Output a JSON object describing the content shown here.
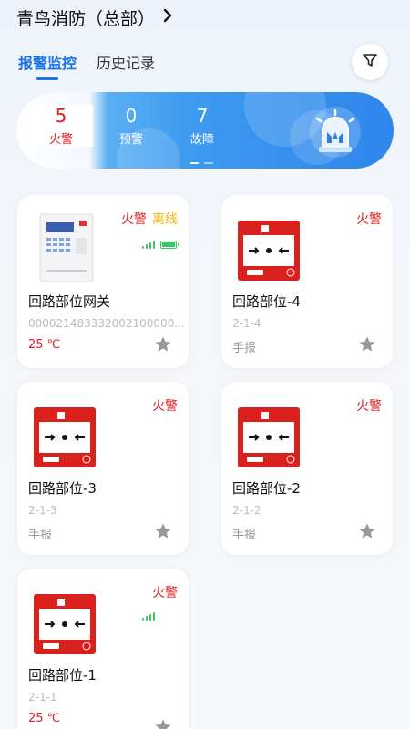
{
  "header": {
    "title": "青鸟消防（总部）"
  },
  "tabs": [
    {
      "label": "报警监控",
      "active": true
    },
    {
      "label": "历史记录",
      "active": false
    }
  ],
  "stats": [
    {
      "value": "5",
      "label": "火警",
      "color": "#e02020"
    },
    {
      "value": "0",
      "label": "预警",
      "color": "#ffffff"
    },
    {
      "value": "7",
      "label": "故障",
      "color": "#ffffff"
    }
  ],
  "banner": {
    "pages": 2,
    "current_page": 1
  },
  "devices": [
    {
      "name": "回路部位网关",
      "sub": "000021483332002100000...",
      "extra": "25 ℃",
      "badge_fire": "火警",
      "badge_offline": "离线",
      "type": "gateway",
      "signal_bars": 4,
      "battery": true,
      "favorite": false
    },
    {
      "name": "回路部位-4",
      "sub": "2-1-4",
      "extra": "手报",
      "badge_fire": "火警",
      "type": "manual-call-point",
      "favorite": false
    },
    {
      "name": "回路部位-3",
      "sub": "2-1-3",
      "extra": "手报",
      "badge_fire": "火警",
      "type": "manual-call-point",
      "favorite": false
    },
    {
      "name": "回路部位-2",
      "sub": "2-1-2",
      "extra": "手报",
      "badge_fire": "火警",
      "type": "manual-call-point",
      "favorite": false
    },
    {
      "name": "回路部位-1",
      "sub": "2-1-1",
      "extra": "25 ℃",
      "badge_fire": "火警",
      "type": "manual-call-point",
      "signal_bars": 4,
      "favorite": false
    }
  ],
  "colors": {
    "accent": "#1a73e8",
    "fire": "#e02020",
    "offline": "#f5b700",
    "signal": "#3ec46d"
  }
}
